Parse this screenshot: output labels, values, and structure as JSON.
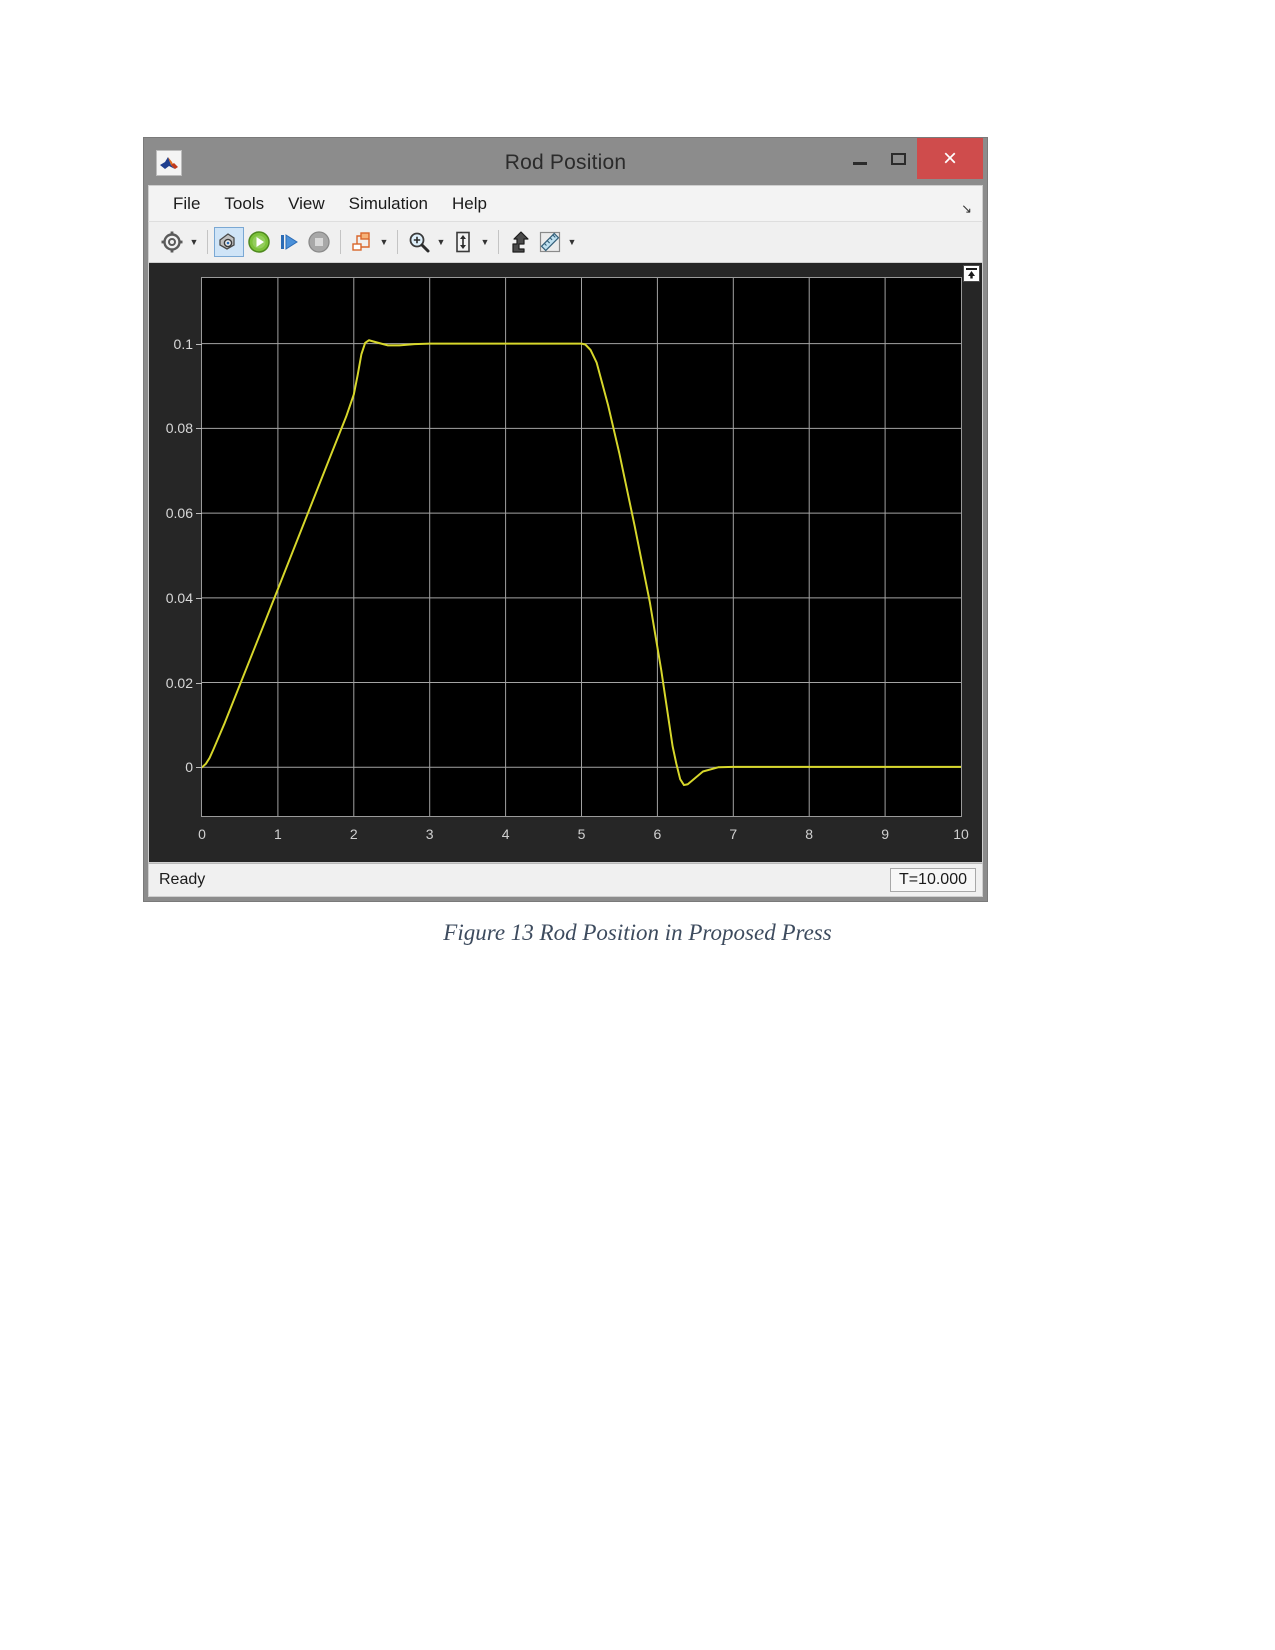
{
  "window": {
    "title": "Rod Position",
    "app_icon": "matlab-scope-icon",
    "minimize_label": "minimize-icon",
    "maximize_label": "maximize-icon",
    "close_label": "×"
  },
  "menu": {
    "items": [
      {
        "label": "File"
      },
      {
        "label": "Tools"
      },
      {
        "label": "View"
      },
      {
        "label": "Simulation"
      },
      {
        "label": "Help"
      }
    ],
    "expand_glyph": "↘"
  },
  "toolbar": {
    "buttons": [
      {
        "name": "configuration-properties-icon",
        "has_arrow": true
      },
      {
        "name": "simulink-link-icon",
        "has_arrow": false,
        "active": true
      },
      {
        "name": "run-icon",
        "has_arrow": false
      },
      {
        "name": "step-forward-icon",
        "has_arrow": false
      },
      {
        "name": "stop-icon",
        "has_arrow": false
      },
      {
        "name": "signal-selection-icon",
        "has_arrow": true
      },
      {
        "name": "zoom-in-icon",
        "has_arrow": true
      },
      {
        "name": "autoscale-icon",
        "has_arrow": true
      },
      {
        "name": "highlight-signal-icon",
        "has_arrow": false
      },
      {
        "name": "cursor-measurements-icon",
        "has_arrow": true
      }
    ]
  },
  "plot": {
    "expand_button": "maximize-axes-icon"
  },
  "status": {
    "message": "Ready",
    "time": "T=10.000"
  },
  "caption": {
    "text": "Figure 13 Rod Position in Proposed Press"
  },
  "colors": {
    "trace": "#d7d72b",
    "plot_background": "#000000",
    "panel_background": "#262626",
    "grid": "#c8c8c8",
    "close_button": "#cf4c4c",
    "title_bar": "#8c8c8c",
    "toolbar_active": "#cfe4f7"
  },
  "chart_data": {
    "type": "line",
    "title": "Rod Position",
    "xlabel": "",
    "ylabel": "",
    "xlim": [
      0,
      10
    ],
    "ylim": [
      -0.0115,
      0.1155
    ],
    "grid": true,
    "legend": null,
    "xticks": [
      0,
      1,
      2,
      3,
      4,
      5,
      6,
      7,
      8,
      9,
      10
    ],
    "xtick_labels": [
      "0",
      "1",
      "2",
      "3",
      "4",
      "5",
      "6",
      "7",
      "8",
      "9",
      "10"
    ],
    "yticks": [
      0,
      0.02,
      0.04,
      0.06,
      0.08,
      0.1
    ],
    "ytick_labels": [
      "0",
      "0.02",
      "0.04",
      "0.06",
      "0.08",
      "0.1"
    ],
    "series": [
      {
        "name": "Rod Position",
        "color": "#d7d72b",
        "x": [
          0,
          0.05,
          0.1,
          0.15,
          0.2,
          0.3,
          0.5,
          0.8,
          1.1,
          1.4,
          1.7,
          1.9,
          2.0,
          2.05,
          2.1,
          2.15,
          2.2,
          2.3,
          2.45,
          2.6,
          2.8,
          3.0,
          3.5,
          4.0,
          4.5,
          5.0,
          5.05,
          5.12,
          5.2,
          5.35,
          5.5,
          5.7,
          5.9,
          6.05,
          6.15,
          6.2,
          6.25,
          6.3,
          6.35,
          6.4,
          6.5,
          6.6,
          6.8,
          7.0,
          7.5,
          8.0,
          8.5,
          9.0,
          9.5,
          10.0
        ],
        "y": [
          0,
          0.0008,
          0.0022,
          0.0042,
          0.0063,
          0.0105,
          0.0195,
          0.033,
          0.0466,
          0.0602,
          0.0738,
          0.0828,
          0.088,
          0.0925,
          0.0975,
          0.1002,
          0.1008,
          0.1003,
          0.0996,
          0.0996,
          0.0999,
          0.1,
          0.1,
          0.1,
          0.1,
          0.1,
          0.0998,
          0.0985,
          0.0955,
          0.0855,
          0.074,
          0.057,
          0.039,
          0.023,
          0.011,
          0.005,
          0.0008,
          -0.0028,
          -0.0042,
          -0.004,
          -0.0025,
          -0.001,
          0.0,
          0.0001,
          0.0001,
          0.0001,
          0.0001,
          0.0001,
          0.0001,
          0.0001
        ]
      }
    ],
    "description": "Trapezoidal rod position profile: ramps linearly from 0 m to 0.1 m between t=0 and t=2.1 s with slight overshoot, holds at 0.1 m until t=5 s, ramps down to 0 m by t=6.3 s with a small undershoot, then remains at 0 m through t=10 s."
  }
}
